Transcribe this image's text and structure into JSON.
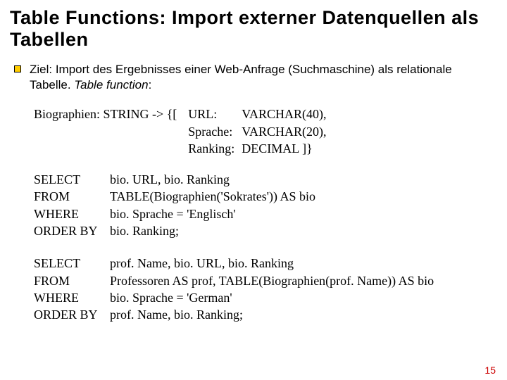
{
  "title": "Table Functions: Import externer Datenquellen als Tabellen",
  "bullet": {
    "lead": "Ziel: Import des Ergebnisses einer Web-Anfrage (Suchmaschine) als relationale Tabelle. ",
    "tf": "Table function",
    "colon": ":"
  },
  "sig": {
    "lhs": "Biographien: STRING -> {[",
    "rows": [
      {
        "label": "URL:",
        "type": "VARCHAR(40),"
      },
      {
        "label": "Sprache:",
        "type": "VARCHAR(20),"
      },
      {
        "label": "Ranking:",
        "type": "DECIMAL     ]}"
      }
    ]
  },
  "sql1": {
    "select": "bio. URL, bio. Ranking",
    "from": "TABLE(Biographien('Sokrates')) AS bio",
    "where": "bio. Sprache = 'Englisch'",
    "orderby": "bio. Ranking;"
  },
  "sql2": {
    "select": "prof. Name, bio. URL, bio. Ranking",
    "from": "Professoren AS prof, TABLE(Biographien(prof. Name)) AS bio",
    "where": "bio. Sprache = 'German'",
    "orderby": "prof. Name, bio. Ranking;"
  },
  "kw": {
    "select": "SELECT",
    "from": "FROM",
    "where": "WHERE",
    "orderby": "ORDER BY"
  },
  "page": "15"
}
